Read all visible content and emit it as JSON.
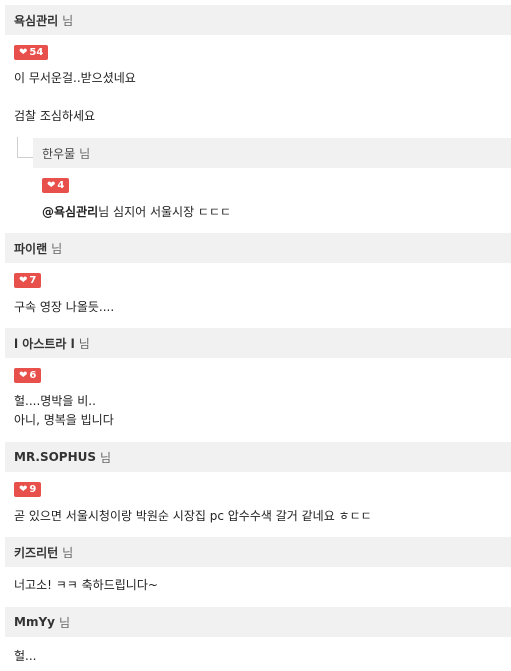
{
  "comments": [
    {
      "user": "욕심관리",
      "suffix": "님",
      "likes": "54",
      "lines": [
        "이 무서운걸..받으셨네요",
        "검찰 조심하세요"
      ]
    },
    {
      "user": "한우물",
      "suffix": "님",
      "likes": "4",
      "mention": "@욕심관리",
      "mention_rest": "님 심지어 서울시장 ㄷㄷㄷ"
    },
    {
      "user": "파이랜",
      "suffix": "님",
      "likes": "7",
      "lines": [
        "구속 영장 나올듯...."
      ]
    },
    {
      "user": "l 아스트라 l",
      "suffix": "님",
      "likes": "6",
      "lines": [
        "헐....명박을 비..",
        "아니, 명복을 빕니다"
      ]
    },
    {
      "user": "MR.SOPHUS",
      "suffix": "님",
      "likes": "9",
      "lines": [
        "곧 있으면 서울시청이랑 박원순 시장집 pc 압수수색 갈거 같네요 ㅎㄷㄷ"
      ]
    },
    {
      "user": "키즈리턴",
      "suffix": "님",
      "lines": [
        "너고소! ㅋㅋ 축하드립니다~"
      ]
    },
    {
      "user": "MmYy",
      "suffix": "님",
      "lines": [
        "헐..."
      ]
    }
  ],
  "colors": {
    "badge": "#e8504b",
    "header_bg": "#f1f1f1"
  },
  "icons": {
    "like": "heart-icon",
    "reply": "reply-elbow-icon"
  }
}
